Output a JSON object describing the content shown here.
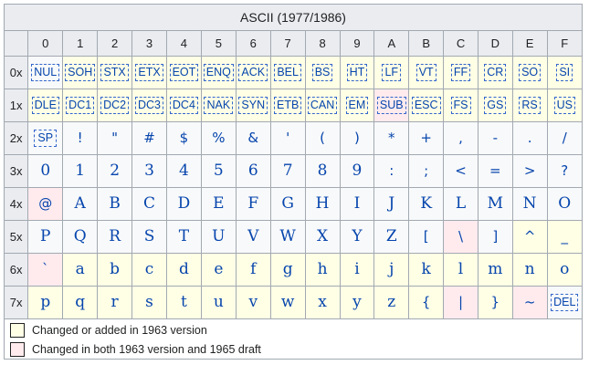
{
  "title": "ASCII (1977/1986)",
  "columns": [
    "0",
    "1",
    "2",
    "3",
    "4",
    "5",
    "6",
    "7",
    "8",
    "9",
    "A",
    "B",
    "C",
    "D",
    "E",
    "F"
  ],
  "rows": [
    {
      "label": "0x",
      "cells": [
        {
          "t": "NUL",
          "k": "code"
        },
        {
          "t": "SOH",
          "k": "code",
          "h": "new"
        },
        {
          "t": "STX",
          "k": "code",
          "h": "new"
        },
        {
          "t": "ETX",
          "k": "code",
          "h": "new"
        },
        {
          "t": "EOT",
          "k": "code",
          "h": "new"
        },
        {
          "t": "ENQ",
          "k": "code",
          "h": "new"
        },
        {
          "t": "ACK",
          "k": "code",
          "h": "new"
        },
        {
          "t": "BEL",
          "k": "code",
          "h": "new"
        },
        {
          "t": "BS",
          "k": "code",
          "h": "new"
        },
        {
          "t": "HT",
          "k": "code",
          "h": "new"
        },
        {
          "t": "LF",
          "k": "code",
          "h": "new"
        },
        {
          "t": "VT",
          "k": "code",
          "h": "new"
        },
        {
          "t": "FF",
          "k": "code",
          "h": "new"
        },
        {
          "t": "CR",
          "k": "code",
          "h": "new"
        },
        {
          "t": "SO",
          "k": "code",
          "h": "new"
        },
        {
          "t": "SI",
          "k": "code",
          "h": "new"
        }
      ]
    },
    {
      "label": "1x",
      "cells": [
        {
          "t": "DLE",
          "k": "code",
          "h": "new"
        },
        {
          "t": "DC1",
          "k": "code",
          "h": "new"
        },
        {
          "t": "DC2",
          "k": "code",
          "h": "new"
        },
        {
          "t": "DC3",
          "k": "code",
          "h": "new"
        },
        {
          "t": "DC4",
          "k": "code",
          "h": "new"
        },
        {
          "t": "NAK",
          "k": "code",
          "h": "new"
        },
        {
          "t": "SYN",
          "k": "code",
          "h": "new"
        },
        {
          "t": "ETB",
          "k": "code",
          "h": "new"
        },
        {
          "t": "CAN",
          "k": "code",
          "h": "new"
        },
        {
          "t": "EM",
          "k": "code",
          "h": "new"
        },
        {
          "t": "SUB",
          "k": "code",
          "h": "both"
        },
        {
          "t": "ESC",
          "k": "code",
          "h": "new"
        },
        {
          "t": "FS",
          "k": "code",
          "h": "new"
        },
        {
          "t": "GS",
          "k": "code",
          "h": "new"
        },
        {
          "t": "RS",
          "k": "code",
          "h": "new"
        },
        {
          "t": "US",
          "k": "code",
          "h": "new"
        }
      ]
    },
    {
      "label": "2x",
      "cells": [
        {
          "t": "SP",
          "k": "sp"
        },
        {
          "t": "!",
          "k": "sym"
        },
        {
          "t": "\"",
          "k": "sym"
        },
        {
          "t": "#",
          "k": "sym"
        },
        {
          "t": "$",
          "k": "sym"
        },
        {
          "t": "%",
          "k": "sym"
        },
        {
          "t": "&",
          "k": "sym"
        },
        {
          "t": "'",
          "k": "sym"
        },
        {
          "t": "(",
          "k": "sym"
        },
        {
          "t": ")",
          "k": "sym"
        },
        {
          "t": "*",
          "k": "sym"
        },
        {
          "t": "+",
          "k": "sym"
        },
        {
          "t": ",",
          "k": "sym"
        },
        {
          "t": "-",
          "k": "sym"
        },
        {
          "t": ".",
          "k": "sym"
        },
        {
          "t": "/",
          "k": "sym"
        }
      ]
    },
    {
      "label": "3x",
      "cells": [
        {
          "t": "0",
          "k": "ltr"
        },
        {
          "t": "1",
          "k": "ltr"
        },
        {
          "t": "2",
          "k": "ltr"
        },
        {
          "t": "3",
          "k": "ltr"
        },
        {
          "t": "4",
          "k": "ltr"
        },
        {
          "t": "5",
          "k": "ltr"
        },
        {
          "t": "6",
          "k": "ltr"
        },
        {
          "t": "7",
          "k": "ltr"
        },
        {
          "t": "8",
          "k": "ltr"
        },
        {
          "t": "9",
          "k": "ltr"
        },
        {
          "t": ":",
          "k": "sym"
        },
        {
          "t": ";",
          "k": "sym"
        },
        {
          "t": "<",
          "k": "sym"
        },
        {
          "t": "=",
          "k": "sym"
        },
        {
          "t": ">",
          "k": "sym"
        },
        {
          "t": "?",
          "k": "sym"
        }
      ]
    },
    {
      "label": "4x",
      "cells": [
        {
          "t": "@",
          "k": "sym",
          "h": "both"
        },
        {
          "t": "A",
          "k": "ltr"
        },
        {
          "t": "B",
          "k": "ltr"
        },
        {
          "t": "C",
          "k": "ltr"
        },
        {
          "t": "D",
          "k": "ltr"
        },
        {
          "t": "E",
          "k": "ltr"
        },
        {
          "t": "F",
          "k": "ltr"
        },
        {
          "t": "G",
          "k": "ltr"
        },
        {
          "t": "H",
          "k": "ltr"
        },
        {
          "t": "I",
          "k": "ltr"
        },
        {
          "t": "J",
          "k": "ltr"
        },
        {
          "t": "K",
          "k": "ltr"
        },
        {
          "t": "L",
          "k": "ltr"
        },
        {
          "t": "M",
          "k": "ltr"
        },
        {
          "t": "N",
          "k": "ltr"
        },
        {
          "t": "O",
          "k": "ltr"
        }
      ]
    },
    {
      "label": "5x",
      "cells": [
        {
          "t": "P",
          "k": "ltr"
        },
        {
          "t": "Q",
          "k": "ltr"
        },
        {
          "t": "R",
          "k": "ltr"
        },
        {
          "t": "S",
          "k": "ltr"
        },
        {
          "t": "T",
          "k": "ltr"
        },
        {
          "t": "U",
          "k": "ltr"
        },
        {
          "t": "V",
          "k": "ltr"
        },
        {
          "t": "W",
          "k": "ltr"
        },
        {
          "t": "X",
          "k": "ltr"
        },
        {
          "t": "Y",
          "k": "ltr"
        },
        {
          "t": "Z",
          "k": "ltr"
        },
        {
          "t": "[",
          "k": "sym"
        },
        {
          "t": "\\",
          "k": "sym",
          "h": "both"
        },
        {
          "t": "]",
          "k": "sym"
        },
        {
          "t": "^",
          "k": "sym",
          "h": "new"
        },
        {
          "t": "_",
          "k": "sym",
          "h": "new"
        }
      ]
    },
    {
      "label": "6x",
      "cells": [
        {
          "t": "`",
          "k": "sym",
          "h": "both"
        },
        {
          "t": "a",
          "k": "ltr",
          "h": "new"
        },
        {
          "t": "b",
          "k": "ltr",
          "h": "new"
        },
        {
          "t": "c",
          "k": "ltr",
          "h": "new"
        },
        {
          "t": "d",
          "k": "ltr",
          "h": "new"
        },
        {
          "t": "e",
          "k": "ltr",
          "h": "new"
        },
        {
          "t": "f",
          "k": "ltr",
          "h": "new"
        },
        {
          "t": "g",
          "k": "ltr",
          "h": "new"
        },
        {
          "t": "h",
          "k": "ltr",
          "h": "new"
        },
        {
          "t": "i",
          "k": "ltr",
          "h": "new"
        },
        {
          "t": "j",
          "k": "ltr",
          "h": "new"
        },
        {
          "t": "k",
          "k": "ltr",
          "h": "new"
        },
        {
          "t": "l",
          "k": "ltr",
          "h": "new"
        },
        {
          "t": "m",
          "k": "ltr",
          "h": "new"
        },
        {
          "t": "n",
          "k": "ltr",
          "h": "new"
        },
        {
          "t": "o",
          "k": "ltr",
          "h": "new"
        }
      ]
    },
    {
      "label": "7x",
      "cells": [
        {
          "t": "p",
          "k": "ltr",
          "h": "new"
        },
        {
          "t": "q",
          "k": "ltr",
          "h": "new"
        },
        {
          "t": "r",
          "k": "ltr",
          "h": "new"
        },
        {
          "t": "s",
          "k": "ltr",
          "h": "new"
        },
        {
          "t": "t",
          "k": "ltr",
          "h": "new"
        },
        {
          "t": "u",
          "k": "ltr",
          "h": "new"
        },
        {
          "t": "v",
          "k": "ltr",
          "h": "new"
        },
        {
          "t": "w",
          "k": "ltr",
          "h": "new"
        },
        {
          "t": "x",
          "k": "ltr",
          "h": "new"
        },
        {
          "t": "y",
          "k": "ltr",
          "h": "new"
        },
        {
          "t": "z",
          "k": "ltr",
          "h": "new"
        },
        {
          "t": "{",
          "k": "sym",
          "h": "new"
        },
        {
          "t": "|",
          "k": "sym",
          "h": "both"
        },
        {
          "t": "}",
          "k": "sym",
          "h": "new"
        },
        {
          "t": "~",
          "k": "sym",
          "h": "both"
        },
        {
          "t": "DEL",
          "k": "code"
        }
      ]
    }
  ],
  "legend": [
    {
      "text": "Changed or added in 1963 version",
      "color": "#ffffe6"
    },
    {
      "text": "Changed in both 1963 version and 1965 draft",
      "color": "#ffebee"
    }
  ],
  "colors": {
    "header": "#eaecf0",
    "cell": "#f8f9fa",
    "link": "#0645ad",
    "border": "#a2a9b1"
  }
}
